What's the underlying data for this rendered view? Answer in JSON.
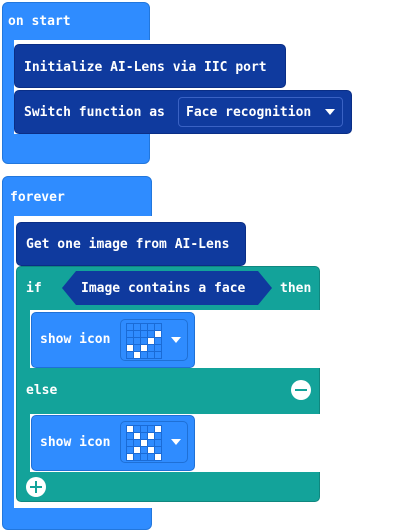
{
  "on_start": {
    "label": "on start",
    "init_block": {
      "text": "Initialize AI-Lens via IIC port"
    },
    "switch_block": {
      "text": "Switch function as",
      "option": "Face recognition"
    }
  },
  "forever": {
    "label": "forever",
    "get_image": {
      "text": "Get one image from AI-Lens"
    },
    "if_block": {
      "if_label": "if",
      "condition": "Image contains a face",
      "then_label": "then",
      "show_icon_then": {
        "text": "show icon",
        "icon": "check-icon"
      },
      "else_label": "else",
      "show_icon_else": {
        "text": "show icon",
        "icon": "cross-icon"
      }
    }
  },
  "colors": {
    "event": "#2f8cff",
    "extension": "#0f3a9e",
    "logic": "#13a39a"
  }
}
